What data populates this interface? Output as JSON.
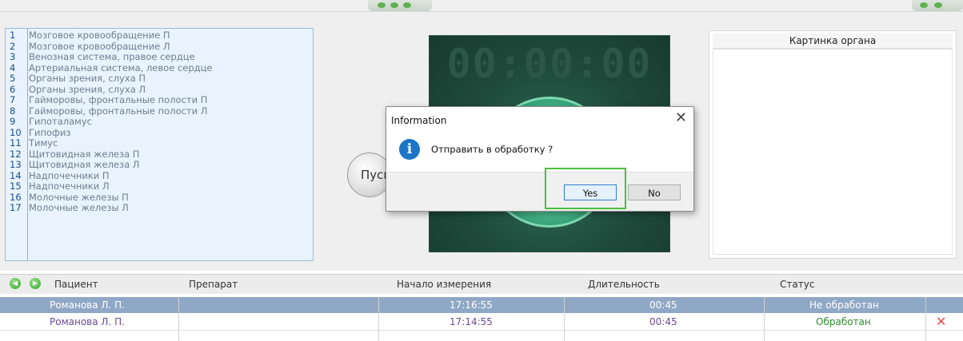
{
  "organ_list": [
    {
      "num": "1",
      "name": "Мозговое кровообращение П"
    },
    {
      "num": "2",
      "name": "Мозговое кровообращение Л"
    },
    {
      "num": "3",
      "name": "Венозная система, правое сердце"
    },
    {
      "num": "4",
      "name": "Артериальная система, левое сердце"
    },
    {
      "num": "5",
      "name": "Органы зрения, слуха П"
    },
    {
      "num": "6",
      "name": "Органы зрения, слуха Л"
    },
    {
      "num": "7",
      "name": "Гайморовы, фронтальные полости П"
    },
    {
      "num": "8",
      "name": "Гайморовы, фронтальные полости Л"
    },
    {
      "num": "9",
      "name": "Гипоталамус"
    },
    {
      "num": "10",
      "name": "Гипофиз"
    },
    {
      "num": "11",
      "name": "Тимус"
    },
    {
      "num": "12",
      "name": "Щитовидная железа П"
    },
    {
      "num": "13",
      "name": "Щитовидная железа Л"
    },
    {
      "num": "14",
      "name": "Надпочечники П"
    },
    {
      "num": "15",
      "name": "Надпочечники Л"
    },
    {
      "num": "16",
      "name": "Молочные железы П"
    },
    {
      "num": "17",
      "name": "Молочные железы Л"
    }
  ],
  "device": {
    "timer": "00:00:00",
    "start_label": "Пуск"
  },
  "organ_picture": {
    "title": "Картинка органа"
  },
  "dialog": {
    "title": "Information",
    "close": "✕",
    "icon": "i",
    "message": "Отправить в обработку ?",
    "yes": "Yes",
    "no": "No"
  },
  "table": {
    "headers": {
      "patient": "Пациент",
      "drug": "Препарат",
      "start": "Начало измерения",
      "duration": "Длительность",
      "status": "Статус"
    },
    "rows": [
      {
        "patient": "Романова Л. П.",
        "drug": "",
        "start": "17:16:55",
        "duration": "00:45",
        "status": "Не обработан"
      },
      {
        "patient": "Романова Л. П.",
        "drug": "",
        "start": "17:14:55",
        "duration": "00:45",
        "status": "Обработан"
      }
    ],
    "delete_icon": "✕"
  },
  "icons": {
    "nav_prev": "◀",
    "nav_next": "▶"
  },
  "colors": {
    "selected_row": "#8fa8c5",
    "status_done": "#2f8a2f",
    "dialog_highlight": "#4cbf40"
  }
}
